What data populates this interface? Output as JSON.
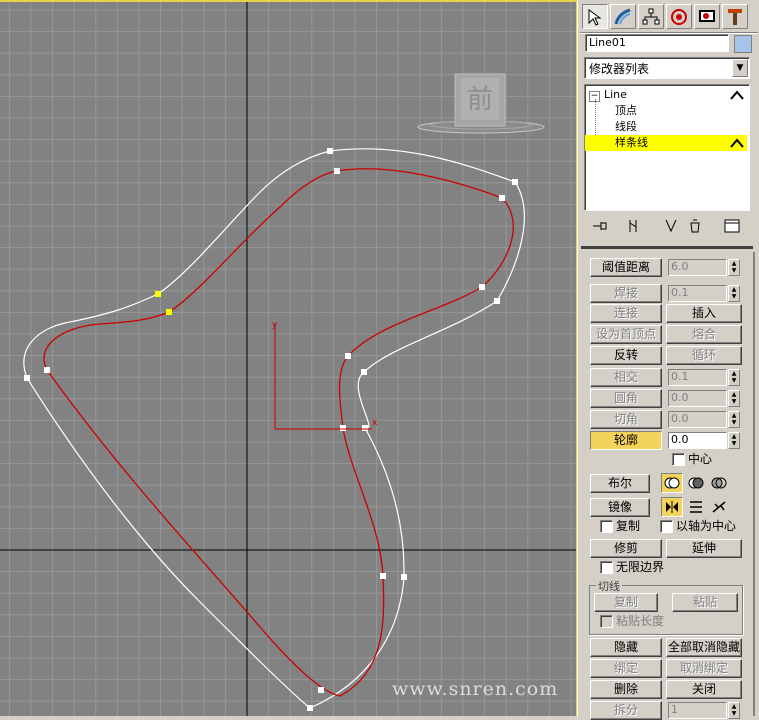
{
  "viewport": {
    "label": "前",
    "watermark": "www.snren.com",
    "axis_x": "x",
    "axis_y": "y"
  },
  "panel": {
    "tabs": [
      {
        "icon": "cursor-icon"
      },
      {
        "icon": "modify-icon"
      },
      {
        "icon": "hierarchy-icon"
      },
      {
        "icon": "motion-icon"
      },
      {
        "icon": "display-icon"
      },
      {
        "icon": "utilities-icon"
      }
    ],
    "object_name": "Line01",
    "object_color": "#a4c4ec",
    "modifier_list": "修改器列表",
    "stack": {
      "root": "Line",
      "items": [
        "顶点",
        "线段",
        "样条线"
      ],
      "selected": "样条线"
    },
    "threshold": {
      "label": "阈值距离",
      "value": "6.0"
    },
    "weld": {
      "label": "焊接",
      "value": "0.1"
    },
    "connect": "连接",
    "insert": "插入",
    "make_first": "设为首顶点",
    "fuse": "熔合",
    "reverse": "反转",
    "cycle": "循环",
    "crossinsert": {
      "label": "相交",
      "value": "0.1"
    },
    "fillet": {
      "label": "圆角",
      "value": "0.0"
    },
    "chamfer": {
      "label": "切角",
      "value": "0.0"
    },
    "outline": {
      "label": "轮廓",
      "value": "0.0"
    },
    "center": "中心",
    "boolean": "布尔",
    "mirror": "镜像",
    "copy": "复制",
    "about_pivot": "以轴为中心",
    "trim": "修剪",
    "extend": "延伸",
    "infinite_bounds": "无限边界",
    "tangent": {
      "title": "切线",
      "copy": "复制",
      "paste": "粘贴",
      "paste_length": "粘贴长度"
    },
    "hide": "隐藏",
    "unhide_all": "全部取消隐藏",
    "bind": "绑定",
    "unbind": "取消绑定",
    "delete": "删除",
    "close": "关闭",
    "divide": {
      "label": "拆分",
      "value": "1"
    }
  }
}
